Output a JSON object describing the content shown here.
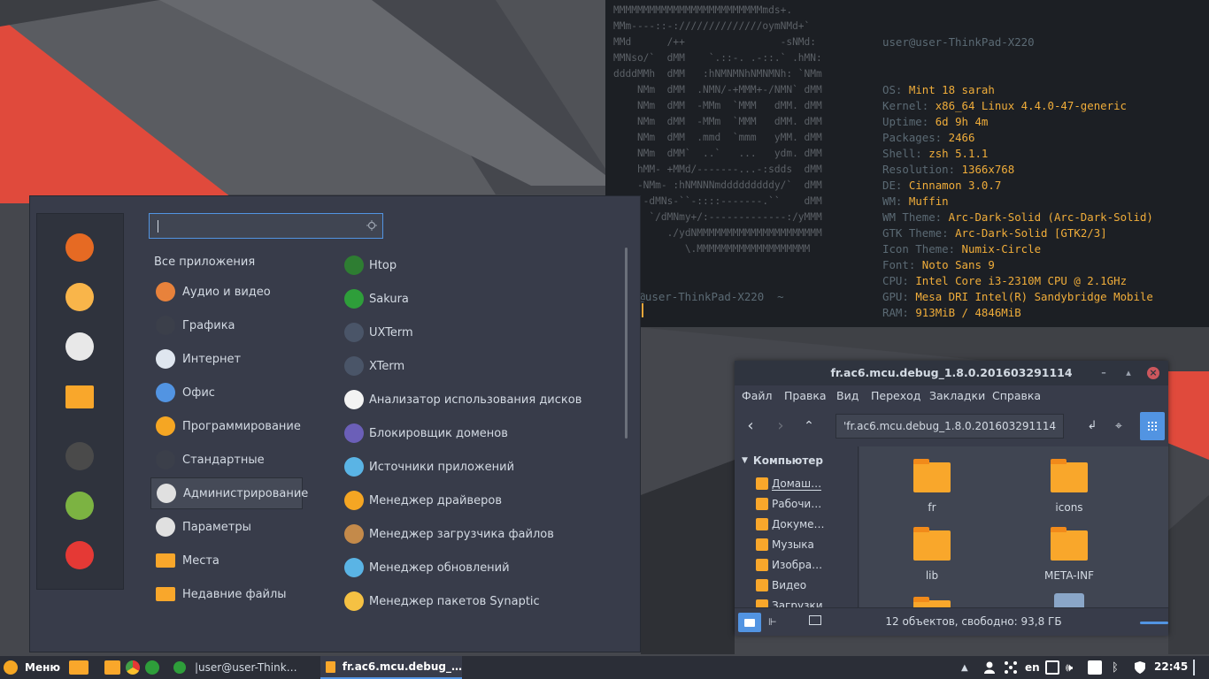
{
  "terminal": {
    "user_host": "user@user-ThinkPad-X220",
    "ascii_art": [
      "MMMMMMMMMMMMMMMMMMMMMMMMMmds+.",
      "MMm----::-://////////////oymNMd+`",
      "MMd      /++                -sNMd:",
      "MMNso/`  dMM    `.::-. .-::.` .hMN:",
      "ddddMMh  dMM   :hNMNMNhNMNMNh: `NMm",
      "    NMm  dMM  .NMN/-+MMM+-/NMN` dMM",
      "    NMm  dMM  -MMm  `MMM   dMM. dMM",
      "    NMm  dMM  -MMm  `MMM   dMM. dMM",
      "    NMm  dMM  .mmd  `mmm   yMM. dMM",
      "    NMm  dMM`  ..`   ...   ydm. dMM",
      "    hMM- +MMd/-------...-:sdds  dMM",
      "    -NMm- :hNMNNNmdddddddddy/`  dMM",
      "     -dMNs-``-::::-------.``    dMM",
      "      `/dMNmy+/:-------------:/yMMM",
      "         ./ydNMMMMMMMMMMMMMMMMMMMMM",
      "            \\.MMMMMMMMMMMMMMMMMMM"
    ],
    "info": [
      {
        "key": "OS:",
        "value": "Mint 18 sarah"
      },
      {
        "key": "Kernel:",
        "value": "x86_64 Linux 4.4.0-47-generic"
      },
      {
        "key": "Uptime:",
        "value": "6d 9h 4m"
      },
      {
        "key": "Packages:",
        "value": "2466"
      },
      {
        "key": "Shell:",
        "value": "zsh 5.1.1"
      },
      {
        "key": "Resolution:",
        "value": "1366x768"
      },
      {
        "key": "DE:",
        "value": "Cinnamon 3.0.7"
      },
      {
        "key": "WM:",
        "value": "Muffin"
      },
      {
        "key": "WM Theme:",
        "value": "Arc-Dark-Solid (Arc-Dark-Solid)"
      },
      {
        "key": "GTK Theme:",
        "value": "Arc-Dark-Solid [GTK2/3]"
      },
      {
        "key": "Icon Theme:",
        "value": "Numix-Circle"
      },
      {
        "key": "Font:",
        "value": "Noto Sans 9"
      },
      {
        "key": "CPU:",
        "value": "Intel Core i3-2310M CPU @ 2.1GHz"
      },
      {
        "key": "GPU:",
        "value": "Mesa DRI Intel(R) Sandybridge Mobile"
      },
      {
        "key": "RAM:",
        "value": "913MiB / 4846MiB"
      }
    ],
    "prompt": "r@user-ThinkPad-X220  ~"
  },
  "menu": {
    "search_value": "",
    "all_apps": "Все приложения",
    "categories": [
      {
        "label": "Аудио и видео",
        "icon": "multimedia-icon",
        "color": "#e8823b"
      },
      {
        "label": "Графика",
        "icon": "graphics-icon",
        "color": "#3b3f4a"
      },
      {
        "label": "Интернет",
        "icon": "internet-icon",
        "color": "#dfe6ef"
      },
      {
        "label": "Офис",
        "icon": "office-icon",
        "color": "#5294e2"
      },
      {
        "label": "Программирование",
        "icon": "programming-icon",
        "color": "#f5a623"
      },
      {
        "label": "Стандартные",
        "icon": "accessories-icon",
        "color": "#3b3f4a"
      },
      {
        "label": "Администрирование",
        "icon": "administration-icon",
        "color": "#e0e0e0"
      },
      {
        "label": "Параметры",
        "icon": "preferences-icon",
        "color": "#e0e0e0"
      },
      {
        "label": "Места",
        "icon": "places-icon",
        "color": "#f9a72b"
      },
      {
        "label": "Недавние файлы",
        "icon": "recent-files-icon",
        "color": "#f9a72b"
      }
    ],
    "selected_category": "Администрирование",
    "apps": [
      {
        "label": "Htop",
        "icon": "htop-icon",
        "color": "#2e7d32"
      },
      {
        "label": "Sakura",
        "icon": "sakura-icon",
        "color": "#2e9e3a"
      },
      {
        "label": "UXTerm",
        "icon": "uxterm-icon",
        "color": "#4a5568"
      },
      {
        "label": "XTerm",
        "icon": "xterm-icon",
        "color": "#4a5568"
      },
      {
        "label": "Анализатор использования дисков",
        "icon": "disk-usage-icon",
        "color": "#f3f3f3"
      },
      {
        "label": "Блокировщик доменов",
        "icon": "domain-blocker-icon",
        "color": "#6b5fb8"
      },
      {
        "label": "Источники приложений",
        "icon": "software-sources-icon",
        "color": "#5ab4e5"
      },
      {
        "label": "Менеджер драйверов",
        "icon": "driver-manager-icon",
        "color": "#f5a623"
      },
      {
        "label": "Менеджер загрузчика файлов",
        "icon": "upload-manager-icon",
        "color": "#c48a4a"
      },
      {
        "label": "Менеджер обновлений",
        "icon": "update-manager-icon",
        "color": "#5ab4e5"
      },
      {
        "label": "Менеджер пакетов Synaptic",
        "icon": "synaptic-icon",
        "color": "#f5c143"
      }
    ],
    "favorites": [
      {
        "icon": "firefox-icon",
        "color": "#e66a23"
      },
      {
        "icon": "mail-icon",
        "color": "#f9b54a"
      },
      {
        "icon": "settings-toggle-icon",
        "color": "#e8e8e8"
      },
      {
        "icon": "folder-icon",
        "color": "#f9a72b"
      },
      {
        "icon": "lock-screen-icon",
        "color": "#4a4a4a"
      },
      {
        "icon": "logout-icon",
        "color": "#7cb342"
      },
      {
        "icon": "shutdown-icon",
        "color": "#e53935"
      }
    ]
  },
  "file_manager": {
    "title": "fr.ac6.mcu.debug_1.8.0.201603291114",
    "menus": [
      "Файл",
      "Правка",
      "Вид",
      "Переход",
      "Закладки",
      "Справка"
    ],
    "path": "'fr.ac6.mcu.debug_1.8.0.201603291114",
    "sidebar_header": "Компьютер",
    "sidebar_items": [
      "Домаш…",
      "Рабочи…",
      "Докуме…",
      "Музыка",
      "Изобра…",
      "Видео",
      "Загрузки"
    ],
    "files": [
      "fr",
      "icons",
      "lib",
      "META-INF"
    ],
    "status": "12 объектов, свободно: 93,8 ГБ"
  },
  "panel": {
    "menu_label": "Меню",
    "windows": [
      {
        "label": "|user@user-Think…"
      },
      {
        "label": "fr.ac6.mcu.debug_…"
      }
    ],
    "keyboard_layout": "en",
    "clock": "22:45"
  },
  "colors": {
    "accent": "#5294e2",
    "terminal_value": "#f0ad3a",
    "folder": "#f9a72b"
  }
}
